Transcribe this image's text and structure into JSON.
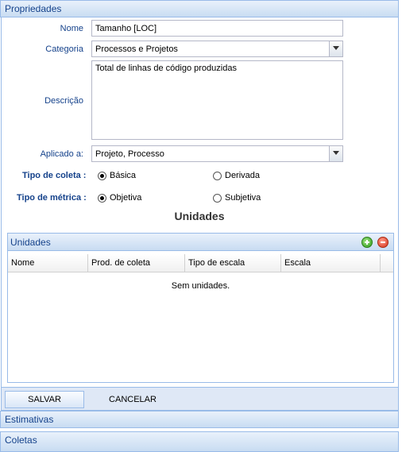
{
  "panel": {
    "title": "Propriedades"
  },
  "form": {
    "nome": {
      "label": "Nome",
      "value": "Tamanho [LOC]"
    },
    "categoria": {
      "label": "Categoria",
      "value": "Processos e Projetos"
    },
    "descricao": {
      "label": "Descrição",
      "value": "Total de linhas de código produzidas"
    },
    "aplicado": {
      "label": "Aplicado a:",
      "value": "Projeto, Processo"
    },
    "tipo_coleta": {
      "label": "Tipo de coleta :",
      "options": [
        {
          "label": "Básica",
          "checked": true
        },
        {
          "label": "Derivada",
          "checked": false
        }
      ]
    },
    "tipo_metrica": {
      "label": "Tipo de métrica :",
      "options": [
        {
          "label": "Objetiva",
          "checked": true
        },
        {
          "label": "Subjetiva",
          "checked": false
        }
      ]
    }
  },
  "unidades": {
    "section_title": "Unidades",
    "grid_title": "Unidades",
    "columns": [
      "Nome",
      "Prod. de coleta",
      "Tipo de escala",
      "Escala"
    ],
    "empty_text": "Sem unidades."
  },
  "buttons": {
    "save": "SALVAR",
    "cancel": "CANCELAR"
  },
  "accordion": {
    "estimativas": "Estimativas",
    "coletas": "Coletas"
  },
  "colors": {
    "header_text": "#15428b",
    "header_border": "#99bbe8"
  }
}
